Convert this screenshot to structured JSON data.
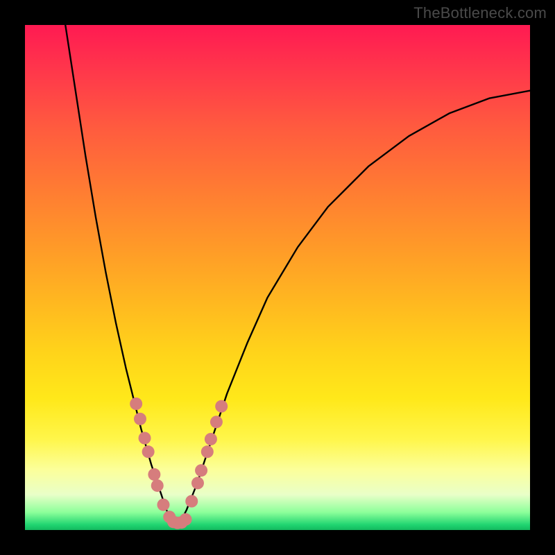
{
  "watermark": "TheBottleneck.com",
  "chart_data": {
    "type": "line",
    "title": "",
    "xlabel": "",
    "ylabel": "",
    "xlim": [
      0,
      100
    ],
    "ylim": [
      0,
      100
    ],
    "background_gradient": [
      "#14b85e",
      "#1fd470",
      "#8cff9a",
      "#fcff9a",
      "#ffe81a",
      "#ff9a28",
      "#ff5a3f",
      "#ff1a52"
    ],
    "series": [
      {
        "name": "left_branch",
        "x": [
          8,
          10,
          12,
          14,
          16,
          18,
          20,
          21,
          22,
          23,
          24,
          25,
          26,
          27,
          28,
          29
        ],
        "y": [
          100,
          87,
          74,
          62,
          51,
          41,
          32,
          28,
          24,
          20,
          16.5,
          13,
          10,
          7,
          4,
          2
        ]
      },
      {
        "name": "right_branch",
        "x": [
          31,
          32,
          33,
          34,
          35,
          36,
          38,
          40,
          44,
          48,
          54,
          60,
          68,
          76,
          84,
          92,
          100
        ],
        "y": [
          2,
          4,
          6.5,
          9,
          12,
          15,
          21,
          27,
          37,
          46,
          56,
          64,
          72,
          78,
          82.5,
          85.5,
          87
        ]
      }
    ],
    "dots": [
      {
        "series": "left_branch",
        "x": 22.0,
        "y": 25.0
      },
      {
        "series": "left_branch",
        "x": 22.8,
        "y": 22.0
      },
      {
        "series": "left_branch",
        "x": 23.7,
        "y": 18.2
      },
      {
        "series": "left_branch",
        "x": 24.4,
        "y": 15.5
      },
      {
        "series": "left_branch",
        "x": 25.6,
        "y": 11.0
      },
      {
        "series": "left_branch",
        "x": 26.2,
        "y": 8.8
      },
      {
        "series": "left_branch",
        "x": 27.4,
        "y": 5.0
      },
      {
        "series": "left_branch",
        "x": 28.6,
        "y": 2.6
      },
      {
        "series": "left_branch",
        "x": 29.4,
        "y": 1.6
      },
      {
        "series": "left_branch",
        "x": 30.2,
        "y": 1.4
      },
      {
        "series": "right_branch",
        "x": 31.0,
        "y": 1.5
      },
      {
        "series": "right_branch",
        "x": 31.8,
        "y": 2.1
      },
      {
        "series": "right_branch",
        "x": 33.0,
        "y": 5.7
      },
      {
        "series": "right_branch",
        "x": 34.2,
        "y": 9.3
      },
      {
        "series": "right_branch",
        "x": 34.9,
        "y": 11.8
      },
      {
        "series": "right_branch",
        "x": 36.1,
        "y": 15.5
      },
      {
        "series": "right_branch",
        "x": 36.8,
        "y": 18.0
      },
      {
        "series": "right_branch",
        "x": 37.9,
        "y": 21.4
      },
      {
        "series": "right_branch",
        "x": 38.9,
        "y": 24.5
      }
    ],
    "dot_color": "#d67d7d",
    "dot_radius": 9
  }
}
